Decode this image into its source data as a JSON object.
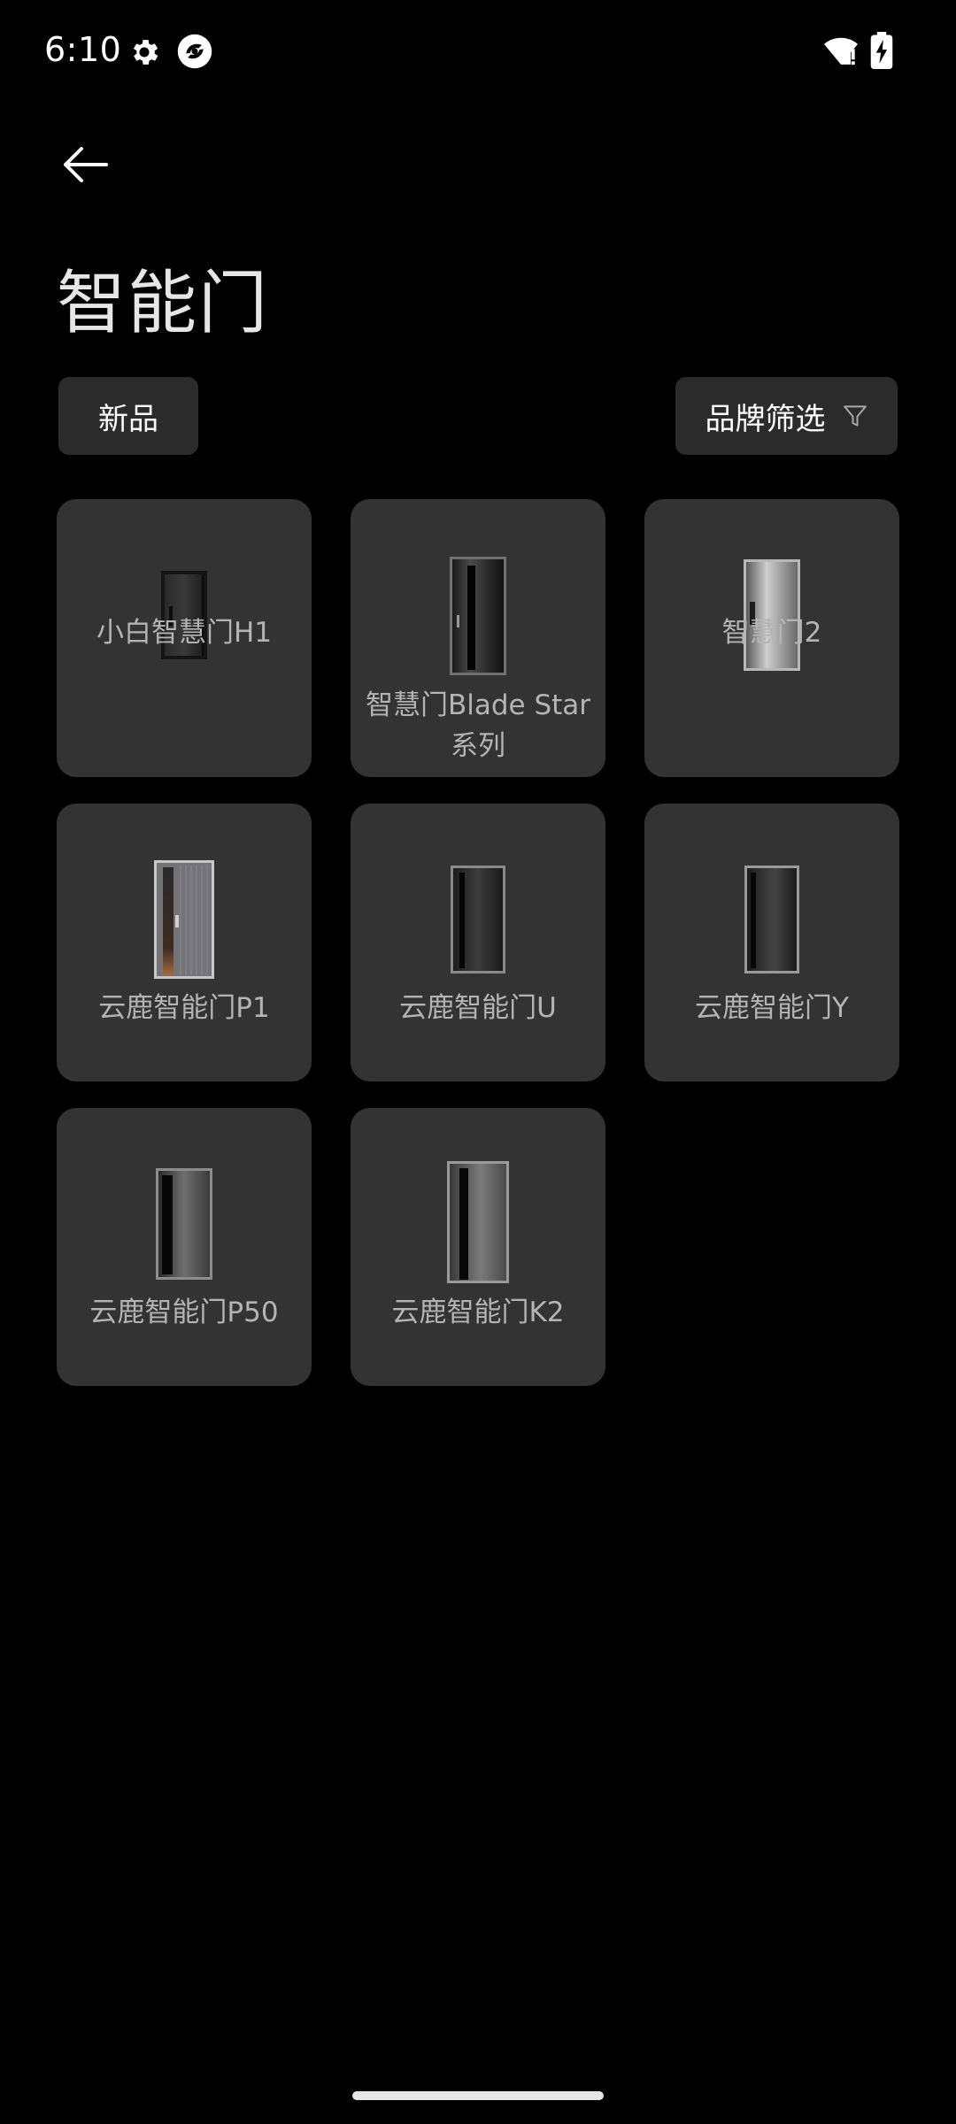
{
  "status_bar": {
    "time": "6:10",
    "icons": [
      "gear-icon",
      "app-notification-icon",
      "wifi-icon",
      "battery-charging-icon"
    ]
  },
  "header": {
    "back_icon": "arrow-left-icon",
    "title": "智能门"
  },
  "filters": {
    "new_label": "新品",
    "brand_label": "品牌筛选",
    "brand_icon": "funnel-icon"
  },
  "products": [
    {
      "name": "小白智慧门H1"
    },
    {
      "name": "智慧门Blade Star系列"
    },
    {
      "name": "智慧门2"
    },
    {
      "name": "云鹿智能门P1"
    },
    {
      "name": "云鹿智能门U"
    },
    {
      "name": "云鹿智能门Y"
    },
    {
      "name": "云鹿智能门P50"
    },
    {
      "name": "云鹿智能门K2"
    }
  ],
  "colors": {
    "background": "#000000",
    "card": "#333333",
    "chip": "#2b2b2b",
    "label": "#b4b4b4",
    "title": "#e6e6e6"
  }
}
